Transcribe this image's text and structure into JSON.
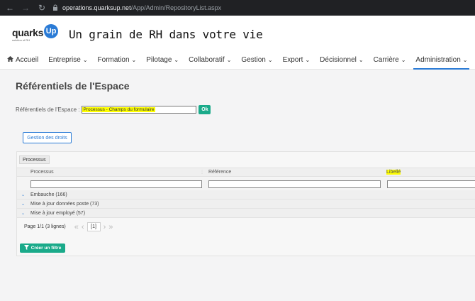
{
  "browser": {
    "url_host": "operations.quarksup.net",
    "url_path": "/App/Admin/RepositoryList.aspx"
  },
  "brand": {
    "name": "quarks",
    "badge": "Up",
    "sub": "solution of RH",
    "tagline": "Un grain de RH dans votre vie"
  },
  "nav": {
    "items": [
      {
        "label": "Accueil"
      },
      {
        "label": "Entreprise"
      },
      {
        "label": "Formation"
      },
      {
        "label": "Pilotage"
      },
      {
        "label": "Collaboratif"
      },
      {
        "label": "Gestion"
      },
      {
        "label": "Export"
      },
      {
        "label": "Décisionnel"
      },
      {
        "label": "Carrière"
      },
      {
        "label": "Administration"
      }
    ]
  },
  "page": {
    "title": "Référentiels de l'Espace",
    "space_label": "Référentiels de l'Espace :",
    "space_value": "Processus - Champs du formulaire",
    "ok_label": "Ok",
    "rights_button": "Gestion des droits"
  },
  "grid": {
    "group_panel": "Processus",
    "columns": [
      "Processus",
      "Référence",
      "Libellé"
    ],
    "groups": [
      {
        "label": "Embauche (166)"
      },
      {
        "label": "Mise à jour données poste (73)"
      },
      {
        "label": "Mise à jour employé (57)"
      }
    ],
    "pager_text": "Page 1/1 (3 lignes)",
    "current_page": "[1]",
    "create_filter": "Créer un filtre"
  }
}
